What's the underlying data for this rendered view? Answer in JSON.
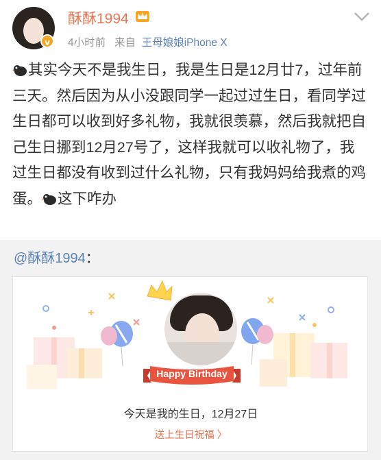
{
  "header": {
    "username": "酥酥1994",
    "time": "4小时前",
    "source_prefix": "来自",
    "source": "王母娘娘iPhone X"
  },
  "post": {
    "text_1": "其实今天不是我生日，我是生日是12月廿7，过年前三天。然后因为从小没跟同学一起过过生日，看同学过生日都可以收到好多礼物，我就很羡慕，然后我就把自己生日挪到12月27号了，这样我就可以收礼物了，我过生日都没有收到过什么礼物，只有我妈妈给我煮的鸡蛋。",
    "text_2": "这下咋办"
  },
  "repost": {
    "mention": "@酥酥1994",
    "colon": "：",
    "card": {
      "banner": "Happy Birthday",
      "title": "今天是我的生日，12月27日",
      "link": "送上生日祝福 〉"
    }
  },
  "colors": {
    "accent": "#eb7350",
    "link": "#5a83b7",
    "gray": "#999999"
  }
}
